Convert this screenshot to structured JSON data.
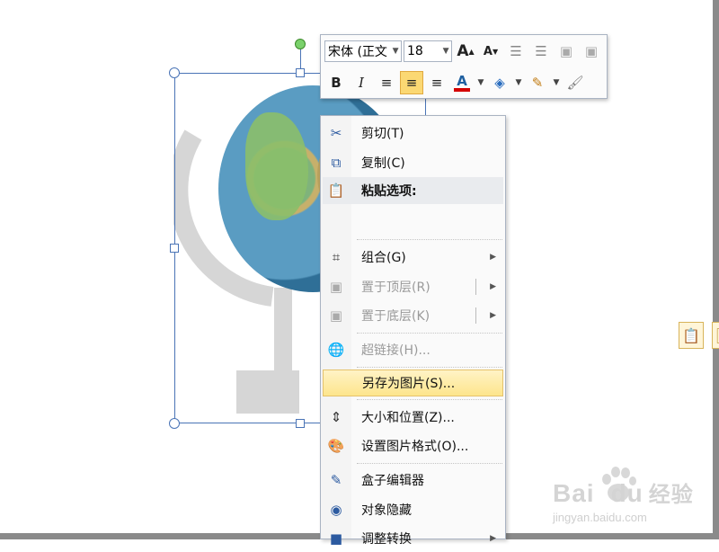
{
  "mini_toolbar": {
    "font_name": "宋体 (正文",
    "font_size": "18",
    "grow_font_icon": "A",
    "shrink_font_icon": "A",
    "bold": "B",
    "italic": "I",
    "font_color_glyph": "A",
    "font_color": "#d40000",
    "active_button": "align-center"
  },
  "context_menu": {
    "items": [
      {
        "label": "剪切(T)",
        "icon": "scissors-icon",
        "enabled": true
      },
      {
        "label": "复制(C)",
        "icon": "copy-icon",
        "enabled": true
      },
      {
        "label": "粘贴选项:",
        "icon": "paste-icon",
        "enabled": true
      },
      {
        "label": "组合(G)",
        "icon": "group-icon",
        "enabled": true
      },
      {
        "label": "置于顶层(R)",
        "icon": "bring-front-icon",
        "enabled": false
      },
      {
        "label": "置于底层(K)",
        "icon": "send-back-icon",
        "enabled": false
      },
      {
        "label": "超链接(H)...",
        "icon": "hyperlink-icon",
        "enabled": false
      },
      {
        "label": "另存为图片(S)...",
        "icon": "",
        "enabled": true,
        "hover": true
      },
      {
        "label": "大小和位置(Z)...",
        "icon": "size-position-icon",
        "enabled": true
      },
      {
        "label": "设置图片格式(O)...",
        "icon": "format-picture-icon",
        "enabled": true
      },
      {
        "label": "盒子编辑器",
        "icon": "edit-icon",
        "enabled": true
      },
      {
        "label": "对象隐藏",
        "icon": "hide-eye-icon",
        "enabled": true
      },
      {
        "label": "调整转换",
        "icon": "adjust-icon",
        "enabled": true
      }
    ]
  },
  "watermark": {
    "brand": "Bai",
    "brand2": "du",
    "brand3": "经验",
    "url": "jingyan.baidu.com"
  }
}
